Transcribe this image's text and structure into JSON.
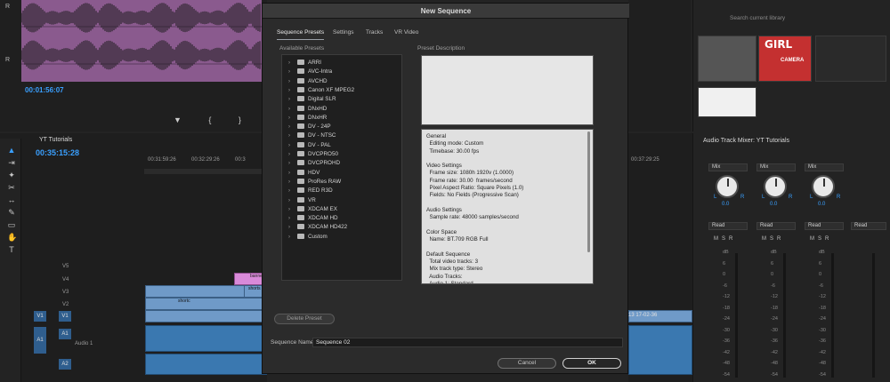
{
  "source_monitor": {
    "timecode": "00:01:56:07",
    "channel_labels": [
      "R",
      "R"
    ]
  },
  "timeline": {
    "title": "YT Tutorials",
    "timecode": "00:35:15:28",
    "ruler": [
      "00:31:59:26",
      "00:32:29:26",
      "00:3"
    ],
    "right_ruler": "00:37:29:25",
    "right_clip_label": "13 17-02-36",
    "tracks": [
      {
        "name": "V5"
      },
      {
        "name": "V4"
      },
      {
        "name": "V3"
      },
      {
        "name": "V2"
      },
      {
        "name": "V1",
        "source": "V1"
      },
      {
        "name": "A1",
        "source": "A1",
        "label": "Audio 1"
      },
      {
        "name": "A2"
      }
    ],
    "clip_labels": {
      "banner": "banne",
      "shorts": "shorts",
      "shortc": "shortc",
      "fx": "fx"
    }
  },
  "dialog": {
    "title": "New Sequence",
    "tabs": [
      "Sequence Presets",
      "Settings",
      "Tracks",
      "VR Video"
    ],
    "available_presets_label": "Available Presets",
    "preset_description_label": "Preset Description",
    "presets": [
      "ARRI",
      "AVC-Intra",
      "AVCHD",
      "Canon XF MPEG2",
      "Digital SLR",
      "DNxHD",
      "DNxHR",
      "DV - 24P",
      "DV - NTSC",
      "DV - PAL",
      "DVCPRO50",
      "DVCPROHD",
      "HDV",
      "ProRes RAW",
      "RED R3D",
      "VR",
      "XDCAM EX",
      "XDCAM HD",
      "XDCAM HD422",
      "Custom"
    ],
    "description": "General\n  Editing mode: Custom\n  Timebase: 30.00 fps\n\nVideo Settings\n  Frame size: 1080h 1920v (1.0000)\n  Frame rate: 30.00  frames/second\n  Pixel Aspect Ratio: Square Pixels (1.0)\n  Fields: No Fields (Progressive Scan)\n\nAudio Settings\n  Sample rate: 48000 samples/second\n\nColor Space\n  Name: BT.709 RGB Full\n\nDefault Sequence\n  Total video tracks: 3\n  Mix track type: Stereo\n  Audio Tracks:\n  Audio 1: Standard",
    "delete_preset_label": "Delete Preset",
    "sequence_name_label": "Sequence Name:",
    "sequence_name_value": "Sequence 02",
    "cancel_label": "Cancel",
    "ok_label": "OK"
  },
  "library": {
    "search_placeholder": "Search current library",
    "thumb_title": "GIRL",
    "thumb_sub": "CAMERA"
  },
  "mixer": {
    "title": "Audio Track Mixer: YT Tutorials",
    "mix_label": "Mix",
    "read_label": "Read",
    "knob_value": "0.0",
    "msr": "MSR",
    "db_scale": [
      "dB",
      "6",
      "0",
      "-6",
      "-12",
      "-18",
      "-24",
      "-30",
      "-36",
      "-42",
      "-48",
      "-54"
    ]
  }
}
